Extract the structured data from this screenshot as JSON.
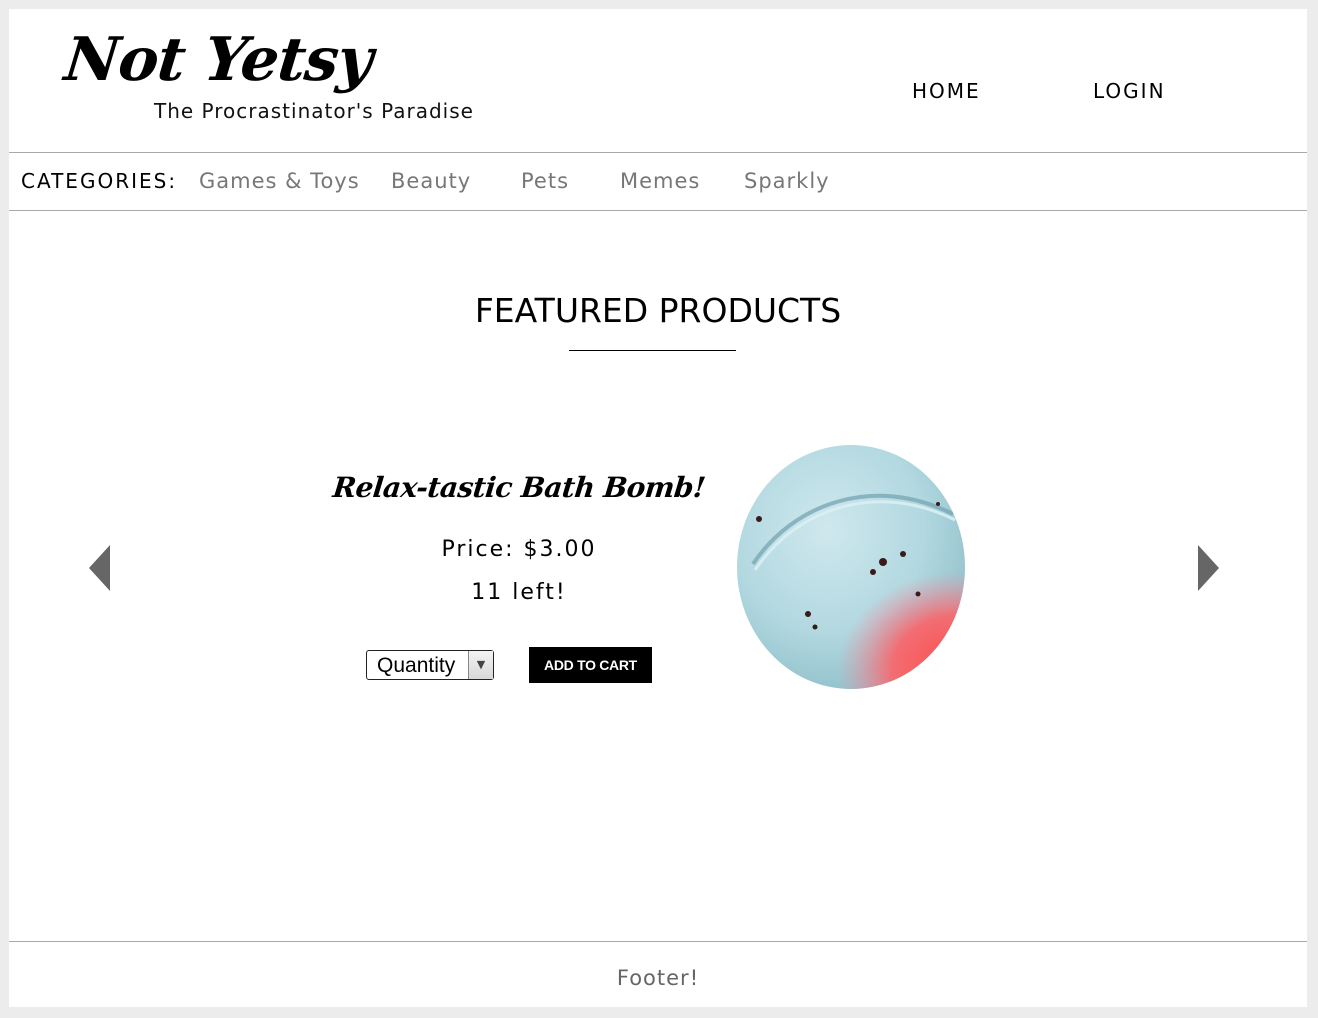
{
  "header": {
    "logo": "Not Yetsy",
    "tagline": "The Procrastinator's Paradise",
    "nav": {
      "home": "HOME",
      "login": "LOGIN"
    }
  },
  "categories": {
    "label": "CATEGORIES:",
    "items": [
      "Games & Toys",
      "Beauty",
      "Pets",
      "Memes",
      "Sparkly"
    ]
  },
  "featured": {
    "title": "FEATURED PRODUCTS",
    "product": {
      "name": "Relax-tastic Bath Bomb!",
      "price": "Price: $3.00",
      "stock": "11 left!",
      "quantity_select": "Quantity",
      "add_to_cart": "ADD TO CART",
      "image_icon": "bath-bomb-image"
    },
    "prev_icon": "arrow-left-icon",
    "next_icon": "arrow-right-icon"
  },
  "footer": {
    "text": "Footer!"
  },
  "colors": {
    "page_background": "#ececec",
    "content_background": "#ffffff",
    "category_text": "#777777",
    "button_background": "#000000",
    "arrow": "#666666"
  }
}
